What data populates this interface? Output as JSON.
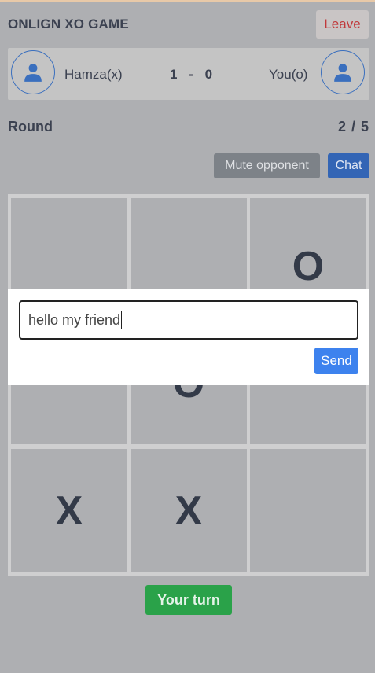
{
  "header": {
    "title": "ONLIGN XO GAME",
    "leave_label": "Leave"
  },
  "players": {
    "left": {
      "name": "Hamza(x)",
      "icon": "user-icon"
    },
    "right": {
      "name": "You(o)",
      "icon": "user-icon"
    },
    "score": {
      "left": "1",
      "separator": "-",
      "right": "0"
    }
  },
  "round": {
    "label": "Round",
    "value": "2 / 5"
  },
  "actions": {
    "mute_label": "Mute opponent",
    "chat_label": "Chat"
  },
  "board": {
    "cells": [
      {
        "mark": ""
      },
      {
        "mark": ""
      },
      {
        "mark": "O"
      },
      {
        "mark": ""
      },
      {
        "mark": "O"
      },
      {
        "mark": ""
      },
      {
        "mark": "X"
      },
      {
        "mark": "X"
      },
      {
        "mark": ""
      }
    ]
  },
  "chat": {
    "input_value": "hello my friend",
    "send_label": "Send"
  },
  "status": {
    "turn_label": "Your turn"
  },
  "colors": {
    "accent_blue": "#3d82ee",
    "leave_red": "#c0393b",
    "turn_green": "#2aa249",
    "mute_gray": "#7d8288",
    "chat_blue": "#3365b5"
  }
}
